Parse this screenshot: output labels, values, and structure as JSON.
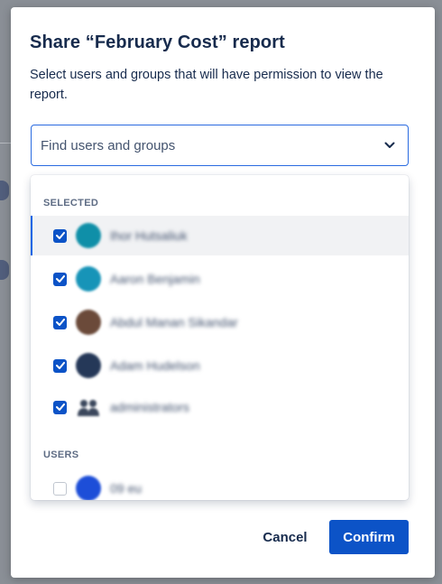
{
  "dialog": {
    "title": "Share “February Cost” report",
    "description": "Select users and groups that will have permission to view the report."
  },
  "search": {
    "placeholder": "Find users and groups",
    "value": ""
  },
  "dropdown": {
    "selected_heading": "SELECTED",
    "selected": [
      {
        "name": "Ihor Hutsaliuk",
        "checked": true,
        "avatar_color": "#0f8fa8",
        "icon": "user-avatar-icon"
      },
      {
        "name": "Aaron Benjamin",
        "checked": true,
        "avatar_color": "#1794b8",
        "icon": "user-avatar-icon"
      },
      {
        "name": "Abdul Manan Sikandar",
        "checked": true,
        "avatar_color": "#6b4a3a",
        "icon": "user-avatar-icon"
      },
      {
        "name": "Adam Hudelson",
        "checked": true,
        "avatar_color": "#253858",
        "icon": "user-avatar-icon"
      },
      {
        "name": "administrators",
        "checked": true,
        "avatar_color": "#3b475c",
        "icon": "group-icon"
      }
    ],
    "users_heading": "USERS",
    "users": [
      {
        "name": "09 eu",
        "checked": false,
        "avatar_color": "#1d4ed8",
        "icon": "user-avatar-icon"
      }
    ]
  },
  "footer": {
    "cancel_label": "Cancel",
    "confirm_label": "Confirm"
  },
  "colors": {
    "primary": "#0c53c7",
    "focus_border": "#2a6be0",
    "text": "#172b4d",
    "overlay": "#8a8f96"
  }
}
